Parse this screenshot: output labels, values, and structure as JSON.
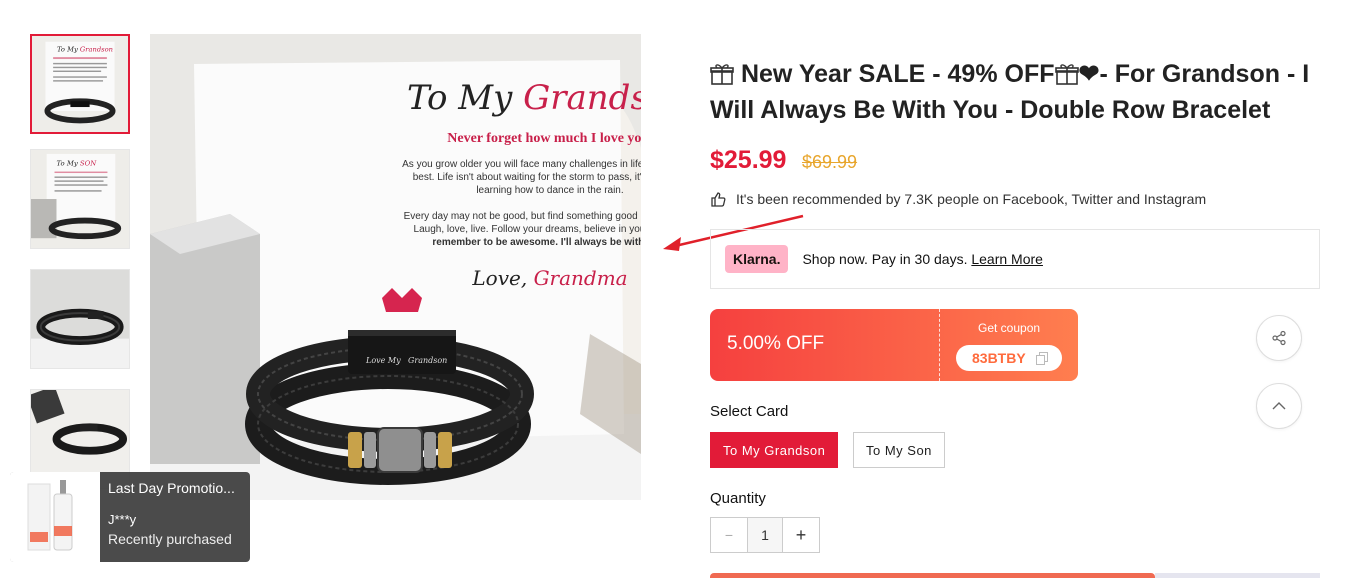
{
  "gallery": {
    "thumbnails": [
      {
        "alt": "To My Grandson card with bracelet",
        "selected": true
      },
      {
        "alt": "To My Son card with bracelet",
        "selected": false
      },
      {
        "alt": "Bracelet close-up",
        "selected": false
      },
      {
        "alt": "Bracelet on desk",
        "selected": false
      }
    ],
    "card": {
      "heading_prefix": "To My",
      "heading_accent": "Grandson,",
      "subtitle": "Never forget how much I love you.",
      "body1": "As you grow older you will face many challenges in life just do your best. Life isn't about waiting for the storm to pass, it's all about learning how to dance in the rain.",
      "body2": "Every day may not be good, but find something good in every day. Laugh, love, live. Follow your dreams, believe in yourself, and",
      "body2_bold": "remember to be awesome. I'll always be with you.",
      "sign_prefix": "Love,",
      "sign_accent": "Grandma",
      "clasp_left": "Love My",
      "clasp_right": "Grandson"
    }
  },
  "product": {
    "title_part1": "New Year SALE - 49% OFF",
    "title_part2": "❤- For Grandson - I Will Always Be With You - Double Row Bracelet",
    "price": "$25.99",
    "compare_price": "$69.99",
    "recommendation": "It's been recommended by 7.3K people on Facebook, Twitter and Instagram"
  },
  "klarna": {
    "badge": "Klarna.",
    "text": "Shop now. Pay in 30 days.",
    "link": "Learn More"
  },
  "coupon": {
    "discount": "5.00% OFF",
    "get_label": "Get coupon",
    "code": "83BTBY"
  },
  "options": {
    "label": "Select Card",
    "values": [
      "To My Grandson",
      "To My Son"
    ],
    "selected_index": 0
  },
  "quantity": {
    "label": "Quantity",
    "value": "1",
    "minus": "−",
    "plus": "+"
  },
  "popup": {
    "title": "Last Day Promotio...",
    "user": "J***y",
    "status": "Recently purchased"
  },
  "icons": {
    "share": "share-icon",
    "scroll_top": "chevron-up-icon",
    "thumbs_up": "thumbs-up-icon",
    "copy": "copy-icon"
  },
  "colors": {
    "accent": "#e21b38",
    "compare_price": "#e8a62d",
    "coupon_start": "#f5403f",
    "coupon_end": "#ff7e4f",
    "klarna_pink": "#ffb3c7"
  }
}
